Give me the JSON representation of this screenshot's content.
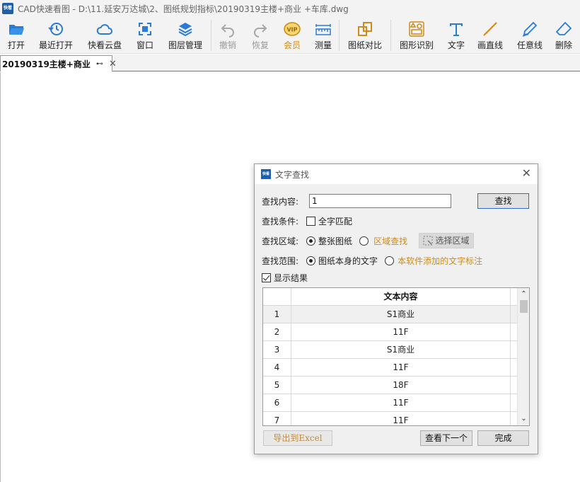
{
  "window": {
    "app_icon_text": "快看",
    "title": "CAD快速看图 - D:\\11.延安万达城\\2、图纸规划指标\\20190319主楼+商业 +车库.dwg"
  },
  "toolbar": {
    "items": [
      {
        "label": "打开",
        "icon": "folder-open-icon"
      },
      {
        "label": "最近打开",
        "icon": "history-icon"
      },
      {
        "label": "快看云盘",
        "icon": "cloud-icon"
      },
      {
        "label": "窗口",
        "icon": "window-fit-icon"
      },
      {
        "label": "图层管理",
        "icon": "layers-icon"
      },
      {
        "label": "撤销",
        "icon": "undo-icon"
      },
      {
        "label": "恢复",
        "icon": "redo-icon"
      },
      {
        "label": "会员",
        "icon": "vip-icon",
        "icon_text": "VIP"
      },
      {
        "label": "测量",
        "icon": "ruler-icon"
      },
      {
        "label": "图纸对比",
        "icon": "compare-icon"
      },
      {
        "label": "图形识别",
        "icon": "shape-recognize-icon"
      },
      {
        "label": "文字",
        "icon": "text-tool-icon"
      },
      {
        "label": "画直线",
        "icon": "line-tool-icon"
      },
      {
        "label": "任意线",
        "icon": "freehand-pen-icon"
      },
      {
        "label": "删除",
        "icon": "eraser-icon"
      }
    ]
  },
  "tabs": {
    "active_tab": "20190319主楼+商业",
    "pin_glyph": "⊷",
    "close_glyph": "✕"
  },
  "dialog": {
    "icon_text": "快看",
    "title": "文字查找",
    "close_glyph": "✕",
    "search": {
      "label": "查找内容:",
      "value": "1",
      "find_button": "查找"
    },
    "condition": {
      "label": "查找条件:",
      "whole_word_label": "全字匹配",
      "whole_word_checked": false
    },
    "area": {
      "label": "查找区域:",
      "option_whole": "整张图纸",
      "option_region": "区域查找",
      "selected": "整张图纸",
      "select_region_button": "选择区域"
    },
    "scope": {
      "label": "查找范围:",
      "option_drawing": "图纸本身的文字",
      "option_annotations": "本软件添加的文字标注",
      "selected": "图纸本身的文字"
    },
    "show_results": {
      "label": "显示结果",
      "checked": true
    },
    "results": {
      "column_header": "文本内容",
      "rows": [
        {
          "index": "1",
          "text": "S1商业"
        },
        {
          "index": "2",
          "text": "11F"
        },
        {
          "index": "3",
          "text": "S1商业"
        },
        {
          "index": "4",
          "text": "11F"
        },
        {
          "index": "5",
          "text": "18F"
        },
        {
          "index": "6",
          "text": "11F"
        },
        {
          "index": "7",
          "text": "11F"
        }
      ],
      "selected_row": "1"
    },
    "buttons": {
      "export": "导出到Excel",
      "next": "查看下一个",
      "done": "完成"
    }
  }
}
